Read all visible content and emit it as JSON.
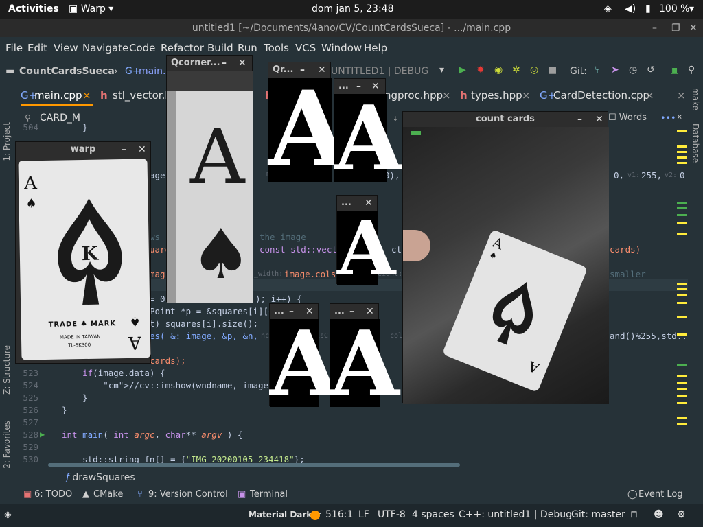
{
  "topbar": {
    "activities": "Activities",
    "app": "Warp",
    "clock": "dom jan  5, 23:48",
    "battery": "100 %"
  },
  "titlebar": {
    "title": "untitled1 [~/Documents/4ano/CV/CountCardsSueca] - .../main.cpp"
  },
  "menu": [
    "File",
    "Edit",
    "View",
    "Navigate",
    "Code",
    "Refactor",
    "Build",
    "Run",
    "Tools",
    "VCS",
    "Window",
    "Help"
  ],
  "nav": {
    "project": "CountCardsSueca",
    "file": "main.",
    "config": "UNTITLED1 | DEBUG",
    "git": "Git:"
  },
  "tabs": [
    "main.cpp",
    "stl_vector.h",
    "ngproc.hpp",
    "types.hpp",
    "CardDetection.cpp"
  ],
  "search": {
    "value": "CARD_M",
    "words": "Words"
  },
  "code": [
    {
      "n": "504",
      "t": "    }"
    },
    {
      "n": "523",
      "t": "    if(image.data) {"
    },
    {
      "n": "524",
      "t": "        //cv::imshow(wndname, image);"
    },
    {
      "n": "525",
      "t": "    }"
    },
    {
      "n": "526",
      "t": "}"
    },
    {
      "n": "527",
      "t": ""
    },
    {
      "n": "528",
      "t": "int main( int argc, char** argv ) {"
    },
    {
      "n": "529",
      "t": ""
    },
    {
      "n": "530",
      "t": "    std::string fn[] = {\"IMG_20200105_234418\"};"
    }
  ],
  "code_fragments": {
    "image_kw": "age,",
    "mg": "mg",
    "paren": "0),",
    "zero": "0,",
    "v1": "v1:",
    "v255": "255,",
    "v2": "v2:",
    "v2val": "0",
    "comment": "the image",
    "const_vec": "const std::vecto",
    "ctor": "ctor<",
    "cards": "cards)",
    "width_hint": "_width:",
    "image_cols": "image.cols",
    "eight": "eight:",
    "smaller": "smaller",
    "for_zero": "= 0;",
    "ipp": "); i++) {",
    "point": "Point *p = &squares[i][0];",
    "size": "t) squares[i].size();",
    "es": "es( &: image, &p, &n,",
    "nc": "nc",
    "isc": "isC",
    "colo": "colo",
    "rand": "and()%255,std::",
    "cards_end": "cards);",
    "ws": "ws",
    "uare": "uare",
    "mag": "mag"
  },
  "func_breadcrumb": "drawSquares",
  "left_rail": {
    "project": "1: Project",
    "structure": "Z: Structure",
    "favorites": "2: Favorites"
  },
  "right_rail": {
    "make": "make",
    "database": "Database"
  },
  "bottom_tools": {
    "todo": "6: TODO",
    "cmake": "CMake",
    "vcs": "9: Version Control",
    "terminal": "Terminal",
    "event_log": "Event Log"
  },
  "status": {
    "theme": "Material Darker",
    "pos": "516:1",
    "lf": "LF",
    "enc": "UTF-8",
    "indent": "4 spaces",
    "ctx": "C++: untitled1 | Debug",
    "git": "Git: master"
  },
  "windows": {
    "warp": "warp",
    "qcorner": "Qcorner...",
    "qr": "Qr...",
    "dots": "...",
    "count_cards": "count cards"
  },
  "card": {
    "rank": "A",
    "trade": "TRADE",
    "mark": "MARK",
    "made": "MADE IN TAIWAN",
    "code": "TL-SK300"
  },
  "colors": {
    "bg": "#263238",
    "accent": "#ff9800",
    "green": "#4caf50",
    "yellow": "#ffeb3b"
  }
}
